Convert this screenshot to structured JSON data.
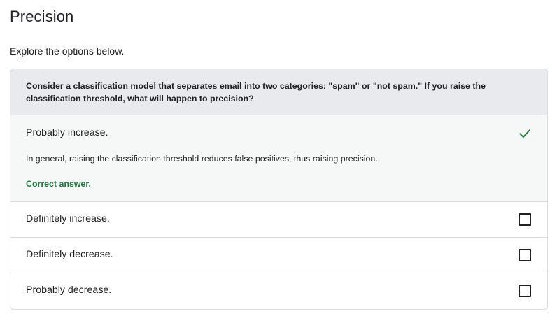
{
  "page": {
    "title": "Precision",
    "intro": "Explore the options below."
  },
  "quiz": {
    "question": "Consider a classification model that separates email into two categories: \"spam\" or \"not spam.\" If you raise the classification threshold, what will happen to precision?",
    "options": [
      {
        "label": "Probably increase.",
        "selected": true,
        "explanation": "In general, raising the classification threshold reduces false positives, thus raising precision.",
        "feedback": "Correct answer.",
        "icon": "check-icon"
      },
      {
        "label": "Definitely increase.",
        "selected": false,
        "icon": "checkbox-icon"
      },
      {
        "label": "Definitely decrease.",
        "selected": false,
        "icon": "checkbox-icon"
      },
      {
        "label": "Probably decrease.",
        "selected": false,
        "icon": "checkbox-icon"
      }
    ]
  },
  "colors": {
    "correct": "#188038",
    "question_bg": "#e8eaed",
    "selected_bg": "#f5f8f6",
    "border": "#dadce0"
  }
}
